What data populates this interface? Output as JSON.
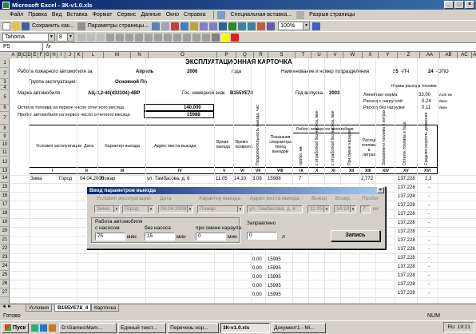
{
  "window": {
    "title": "Microsoft Excel - 3К-v1.0.xls",
    "min": "_",
    "max": "□",
    "close": "×"
  },
  "menu": [
    "Файл",
    "Правка",
    "Вид",
    "Вставка",
    "Формат",
    "Сервис",
    "Данные",
    "Окно",
    "Справка",
    "Специальная вставка...",
    "Разрыв страницы"
  ],
  "toolbar1": {
    "save_as": "Сохранить как...",
    "page_params": "Параметры страницы...",
    "zoom": "100%"
  },
  "toolbar2": {
    "font": "Tahoma",
    "size": "8"
  },
  "formula": {
    "namebox": "P5",
    "fx": "fx"
  },
  "columns": [
    "A",
    "B",
    "C",
    "D",
    "E",
    "F",
    "G",
    "H",
    "I",
    "J",
    "K",
    "L",
    "M",
    "N",
    "O",
    "P",
    "Q",
    "R",
    "S",
    "T",
    "U",
    "V",
    "W",
    "X",
    "Y",
    "Z",
    "AA",
    "AB",
    "AC",
    "AD"
  ],
  "rows": [
    "1",
    "2",
    "3",
    "4",
    "5",
    "6",
    "7",
    "8",
    "9",
    "10",
    "11",
    "12",
    "13",
    "14",
    "15",
    "16",
    "17",
    "18",
    "19",
    "20",
    "21",
    "22",
    "23",
    "24",
    "25",
    "26",
    "27"
  ],
  "sheet": {
    "title": "ЭКСПЛУАТАЦИОННАЯ КАРТОЧКА",
    "r2_label": "Работа пожарного автомобиля за",
    "month": "Апрель",
    "year": "2006",
    "year_unit": "года",
    "dept_label": "Наименование и номер подразделения",
    "dept1": "35",
    "dept1_unit": "-ПЧ",
    "dept2": "24",
    "dept2_unit": "-ОПО",
    "group_label": "Группа эксплуатации:",
    "group_val": "Основной ПА",
    "car_label": "Марка автомобиля",
    "car_val": "АЦ-3,2-40(433104)-4ВР",
    "reg_label": "Гос. номерной знак",
    "reg_val": "В155УЕ78",
    "made_label": "Год выпуска",
    "made_val": "2003",
    "norm_title": "Нормы расхода топлива",
    "norm1_l": "Линейная норма",
    "norm1_v": "33,00",
    "norm1_u": "л/100 км",
    "norm2_l": "Расход с нагрузкой",
    "norm2_v": "0,24",
    "norm2_u": "л/мин",
    "norm3_l": "Расход без нагрузки",
    "norm3_v": "0,11",
    "norm3_u": "л/мин",
    "fuel_label": "Остаток топлива на первое число отчетного месяца",
    "fuel_val": "140,000",
    "km_label": "Пробег автомобиля на первое число отчетного месяца",
    "km_val": "15988",
    "h_cond": "Условия эксплуатации",
    "h_date": "Дата",
    "h_char": "Характер выезда",
    "h_addr": "Адрес места выезда",
    "h_out": "Время выезда",
    "h_back": "Время возврата",
    "h_run": "Продолжительность выезда, час",
    "h_odo": "Показания спидометра перед выездом",
    "h_work": "Работа пожарного автомобиля",
    "h_w1": "пробег, км",
    "h_w2": "с отработкой без насоса, мин",
    "h_w3": "с отработкой без насоса, мин",
    "h_w4": "При смене караула",
    "h_fuel": "Расход топлива в литрах",
    "h_a": "Заправлено топлива в литрах",
    "h_b": "Остаток топлива в баке",
    "h_c": "Средняя скорость движения",
    "nums": [
      "I",
      "II",
      "III",
      "IV",
      "V",
      "VI",
      "VII",
      "VIII",
      "IX",
      "X",
      "XI",
      "XII",
      "XIII",
      "XIV",
      "XV",
      "XVI"
    ],
    "r14": {
      "season": "Зима",
      "place": "Город",
      "date": "04.04.2006",
      "char": "Пожар",
      "addr": "ул. Тамбасова, д. 6",
      "out": "11:05",
      "back": "14:10",
      "run": "3,08",
      "odo": "15988",
      "km": "7",
      "fuel": "2,772",
      "rest": "137,228",
      "speed": "2,3"
    },
    "rest_rows": [
      "137,228",
      "137,228",
      "137,228",
      "137,228",
      "137,228",
      "137,228",
      "137,228",
      "137,228",
      "137,228",
      "137,228",
      "137,228",
      "137,228",
      "137,228"
    ],
    "low_zero": "0,00",
    "low_odo": "15995",
    "low_dash": "-"
  },
  "dialog": {
    "title": "Ввод параметров выезда",
    "close": "×",
    "l_cond": "Условия эксплуатации",
    "l_date": "Дата",
    "l_char": "Характер выезда",
    "l_addr": "Адрес места выезда",
    "l_out": "Выезд",
    "l_back": "Возвр.",
    "l_km": "Пробег",
    "v_season": "Зима",
    "v_place": "Город",
    "v_date": "04.04.2006",
    "v_char": "Пожар",
    "v_addr": "ул. Тамбасова, д. 6",
    "v_out": "11:05",
    "v_back": "14:10",
    "v_km": "7",
    "v_km_unit": "км",
    "work_group": "Работа автомобиля",
    "l_pump": "с насосом",
    "l_nopump": "без насоса",
    "l_shift": "при смене караула",
    "v_pump": "75",
    "v_nopump": "15",
    "v_shift": "0",
    "min": "мин",
    "l_fill": "Заправлено",
    "v_fill": "0",
    "l_unit": "л",
    "btn": "Запись"
  },
  "tabs": [
    "Условия",
    "В155УЕ78_4",
    "Карточка"
  ],
  "status": "Готово",
  "status_num": "NUM",
  "taskbar": {
    "start": "Пуск",
    "items": [
      "D:\\Games\\Mam...",
      "Единый текст...",
      "Перечень нор...",
      "3К-v1.0.xls",
      "Документ1 - Mi..."
    ],
    "time": "19:21",
    "lang": "RU"
  }
}
